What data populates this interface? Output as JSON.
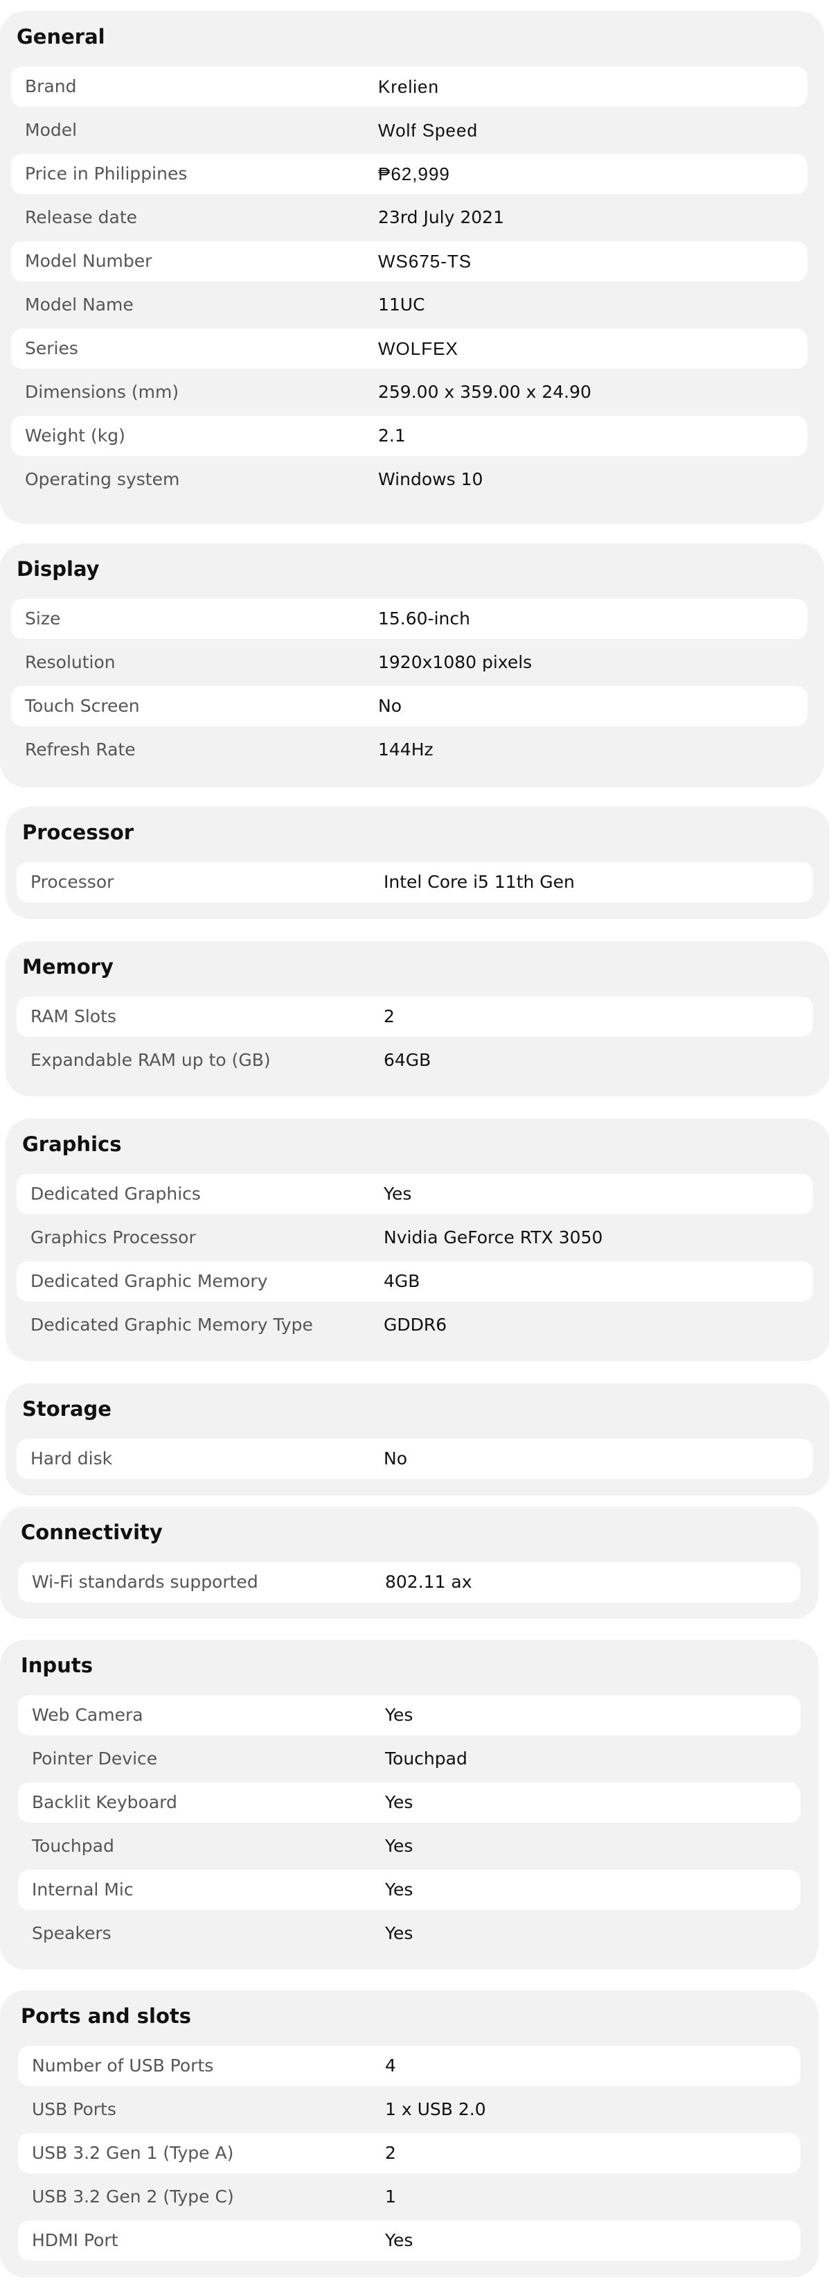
{
  "sections": [
    {
      "title": "General",
      "rows": [
        {
          "label": "Brand",
          "value": "Krelien"
        },
        {
          "label": "Model",
          "value": "Wolf Speed"
        },
        {
          "label": "Price in Philippines",
          "value": "₱62,999"
        },
        {
          "label": "Release date",
          "value": "23rd July 2021"
        },
        {
          "label": "Model Number",
          "value": "WS675-TS"
        },
        {
          "label": "Model Name",
          "value": "11UC"
        },
        {
          "label": "Series",
          "value": "WOLFEX"
        },
        {
          "label": "Dimensions (mm)",
          "value": "259.00 x 359.00 x 24.90"
        },
        {
          "label": "Weight (kg)",
          "value": "2.1"
        },
        {
          "label": "Operating system",
          "value": "Windows 10"
        }
      ]
    },
    {
      "title": "Display",
      "rows": [
        {
          "label": "Size",
          "value": "15.60-inch"
        },
        {
          "label": "Resolution",
          "value": "1920x1080 pixels"
        },
        {
          "label": "Touch Screen",
          "value": "No"
        },
        {
          "label": "Refresh Rate",
          "value": "144Hz"
        }
      ]
    },
    {
      "title": "Processor",
      "rows": [
        {
          "label": "Processor",
          "value": "Intel Core i5 11th Gen"
        }
      ]
    },
    {
      "title": "Memory",
      "rows": [
        {
          "label": "RAM Slots",
          "value": "2"
        },
        {
          "label": "Expandable RAM up to (GB)",
          "value": "64GB"
        }
      ]
    },
    {
      "title": "Graphics",
      "rows": [
        {
          "label": "Dedicated Graphics",
          "value": "Yes"
        },
        {
          "label": "Graphics Processor",
          "value": "Nvidia GeForce RTX 3050"
        },
        {
          "label": "Dedicated Graphic Memory",
          "value": "4GB"
        },
        {
          "label": "Dedicated Graphic Memory Type",
          "value": "GDDR6"
        }
      ]
    },
    {
      "title": "Storage",
      "rows": [
        {
          "label": "Hard disk",
          "value": "No"
        }
      ]
    },
    {
      "title": "Connectivity",
      "rows": [
        {
          "label": "Wi-Fi standards supported",
          "value": "802.11 ax"
        }
      ]
    },
    {
      "title": "Inputs",
      "rows": [
        {
          "label": "Web Camera",
          "value": "Yes"
        },
        {
          "label": "Pointer Device",
          "value": "Touchpad"
        },
        {
          "label": "Backlit Keyboard",
          "value": "Yes"
        },
        {
          "label": "Touchpad",
          "value": "Yes"
        },
        {
          "label": "Internal Mic",
          "value": "Yes"
        },
        {
          "label": "Speakers",
          "value": "Yes"
        }
      ]
    },
    {
      "title": "Ports and slots",
      "rows": [
        {
          "label": "Number of USB Ports",
          "value": "4"
        },
        {
          "label": "USB Ports",
          "value": "1 x USB 2.0"
        },
        {
          "label": "USB 3.2 Gen 1 (Type A)",
          "value": "2"
        },
        {
          "label": "USB 3.2 Gen 2 (Type C)",
          "value": "1"
        },
        {
          "label": "HDMI Port",
          "value": "Yes"
        }
      ]
    }
  ]
}
